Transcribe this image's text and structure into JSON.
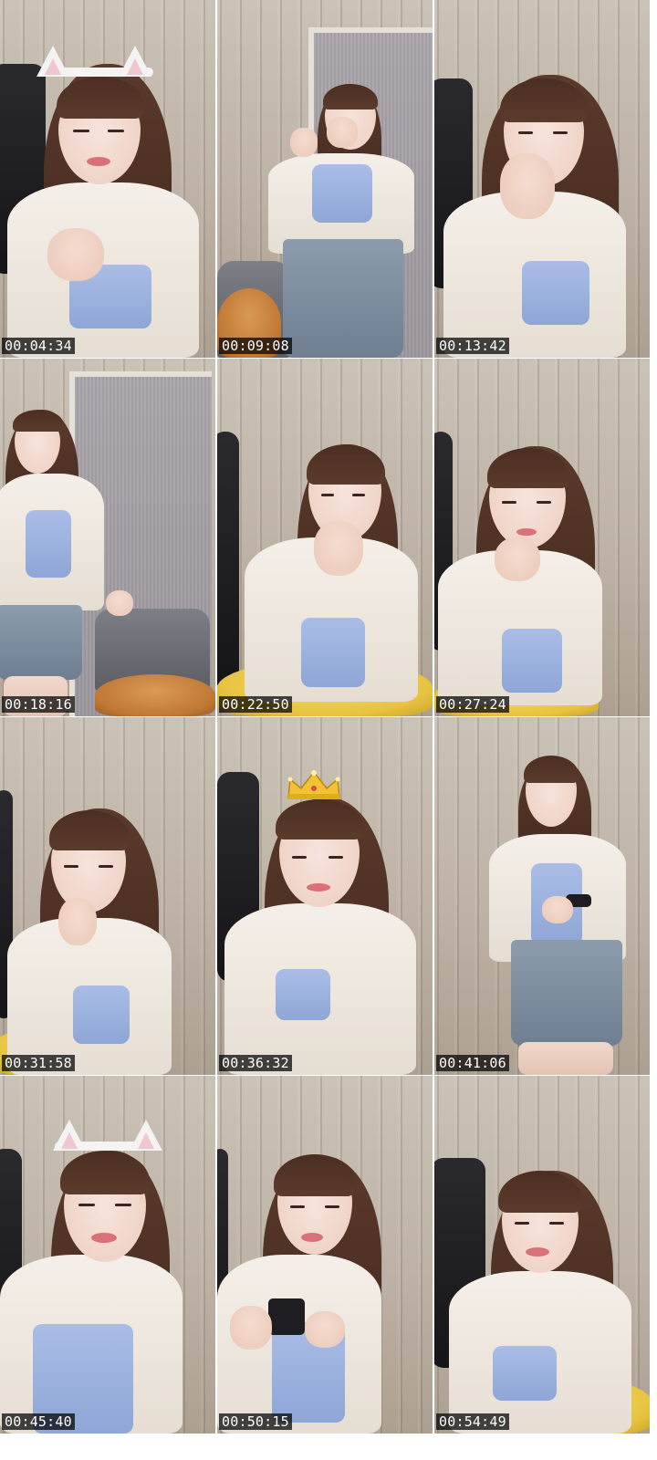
{
  "contact_sheet": {
    "frames": [
      {
        "timestamp": "00:04:34",
        "scene": "cat-ears-smile"
      },
      {
        "timestamp": "00:09:08",
        "scene": "standing-laugh"
      },
      {
        "timestamp": "00:13:42",
        "scene": "hand-to-mouth"
      },
      {
        "timestamp": "00:18:16",
        "scene": "standing-chair"
      },
      {
        "timestamp": "00:22:50",
        "scene": "laugh-seated"
      },
      {
        "timestamp": "00:27:24",
        "scene": "chin-rest"
      },
      {
        "timestamp": "00:31:58",
        "scene": "finger-to-lip"
      },
      {
        "timestamp": "00:36:32",
        "scene": "crown-filter"
      },
      {
        "timestamp": "00:41:06",
        "scene": "standing-phone"
      },
      {
        "timestamp": "00:45:40",
        "scene": "cat-ears-close"
      },
      {
        "timestamp": "00:50:15",
        "scene": "holding-phone"
      },
      {
        "timestamp": "00:54:49",
        "scene": "smile-yellow-cushion"
      }
    ]
  }
}
